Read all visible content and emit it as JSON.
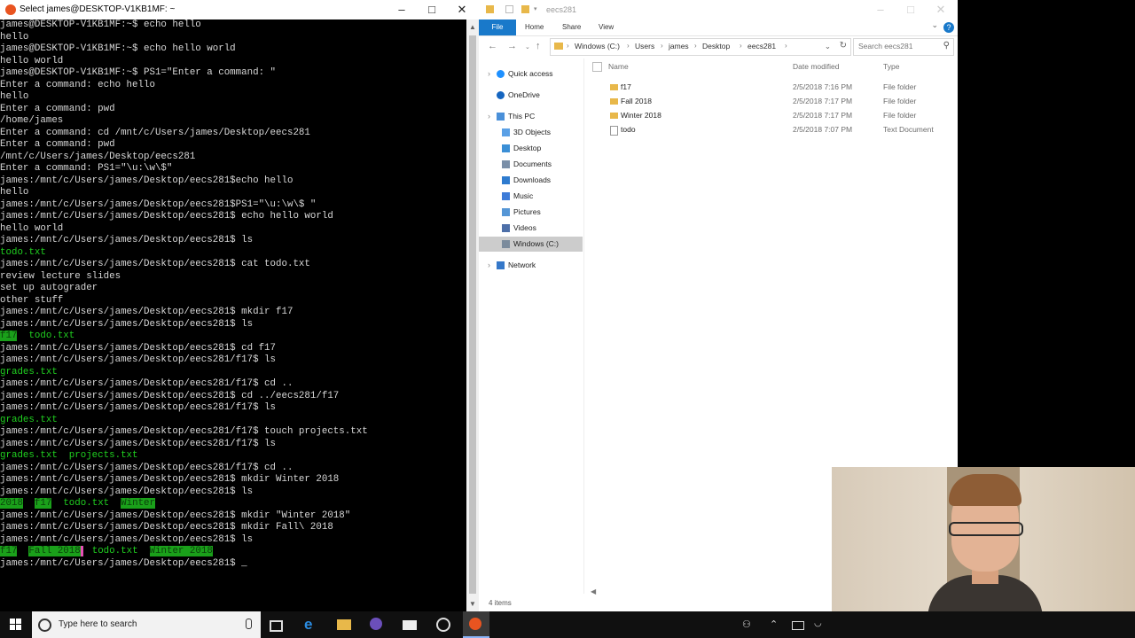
{
  "terminal": {
    "title": "Select james@DESKTOP-V1KB1MF: ~",
    "lines": [
      [
        {
          "t": "james@DESKTOP-V1KB1MF:~$ echo hello"
        }
      ],
      [
        {
          "t": "hello"
        }
      ],
      [
        {
          "t": "james@DESKTOP-V1KB1MF:~$ echo hello world"
        }
      ],
      [
        {
          "t": "hello world"
        }
      ],
      [
        {
          "t": "james@DESKTOP-V1KB1MF:~$ PS1=\"Enter a command: \""
        }
      ],
      [
        {
          "t": "Enter a command: echo hello"
        }
      ],
      [
        {
          "t": "hello"
        }
      ],
      [
        {
          "t": "Enter a command: pwd"
        }
      ],
      [
        {
          "t": "/home/james"
        }
      ],
      [
        {
          "t": "Enter a command: cd /mnt/c/Users/james/Desktop/eecs281"
        }
      ],
      [
        {
          "t": "Enter a command: pwd"
        }
      ],
      [
        {
          "t": "/mnt/c/Users/james/Desktop/eecs281"
        }
      ],
      [
        {
          "t": "Enter a command: PS1=\"\\u:\\w\\$\""
        }
      ],
      [
        {
          "t": "james:/mnt/c/Users/james/Desktop/eecs281$echo hello"
        }
      ],
      [
        {
          "t": "hello"
        }
      ],
      [
        {
          "t": "james:/mnt/c/Users/james/Desktop/eecs281$PS1=\"\\u:\\w\\$ \""
        }
      ],
      [
        {
          "t": "james:/mnt/c/Users/james/Desktop/eecs281$ echo hello world"
        }
      ],
      [
        {
          "t": "hello world"
        }
      ],
      [
        {
          "t": "james:/mnt/c/Users/james/Desktop/eecs281$ ls"
        }
      ],
      [
        {
          "t": "todo.txt",
          "c": "green"
        }
      ],
      [
        {
          "t": "james:/mnt/c/Users/james/Desktop/eecs281$ cat todo.txt"
        }
      ],
      [
        {
          "t": "review lecture slides"
        }
      ],
      [
        {
          "t": "set up autograder"
        }
      ],
      [
        {
          "t": "other stuff"
        }
      ],
      [
        {
          "t": "james:/mnt/c/Users/james/Desktop/eecs281$ mkdir f17"
        }
      ],
      [
        {
          "t": "james:/mnt/c/Users/james/Desktop/eecs281$ ls"
        }
      ],
      [
        {
          "t": "f17",
          "c": "hl"
        },
        {
          "t": "  "
        },
        {
          "t": "todo.txt",
          "c": "green"
        }
      ],
      [
        {
          "t": "james:/mnt/c/Users/james/Desktop/eecs281$ cd f17"
        }
      ],
      [
        {
          "t": "james:/mnt/c/Users/james/Desktop/eecs281/f17$ ls"
        }
      ],
      [
        {
          "t": "grades.txt",
          "c": "green"
        }
      ],
      [
        {
          "t": "james:/mnt/c/Users/james/Desktop/eecs281/f17$ cd .."
        }
      ],
      [
        {
          "t": "james:/mnt/c/Users/james/Desktop/eecs281$ cd ../eecs281/f17"
        }
      ],
      [
        {
          "t": "james:/mnt/c/Users/james/Desktop/eecs281/f17$ ls"
        }
      ],
      [
        {
          "t": "grades.txt",
          "c": "green"
        }
      ],
      [
        {
          "t": "james:/mnt/c/Users/james/Desktop/eecs281/f17$ touch projects.txt"
        }
      ],
      [
        {
          "t": "james:/mnt/c/Users/james/Desktop/eecs281/f17$ ls"
        }
      ],
      [
        {
          "t": "grades.txt",
          "c": "green"
        },
        {
          "t": "  "
        },
        {
          "t": "projects.txt",
          "c": "green"
        }
      ],
      [
        {
          "t": "james:/mnt/c/Users/james/Desktop/eecs281/f17$ cd .."
        }
      ],
      [
        {
          "t": "james:/mnt/c/Users/james/Desktop/eecs281$ mkdir Winter 2018"
        }
      ],
      [
        {
          "t": "james:/mnt/c/Users/james/Desktop/eecs281$ ls"
        }
      ],
      [
        {
          "t": "2018",
          "c": "hl"
        },
        {
          "t": "  "
        },
        {
          "t": "f17",
          "c": "hl"
        },
        {
          "t": "  "
        },
        {
          "t": "todo.txt",
          "c": "green"
        },
        {
          "t": "  "
        },
        {
          "t": "Winter",
          "c": "hl"
        }
      ],
      [
        {
          "t": "james:/mnt/c/Users/james/Desktop/eecs281$ mkdir \"Winter 2018\""
        }
      ],
      [
        {
          "t": "james:/mnt/c/Users/james/Desktop/eecs281$ mkdir Fall\\ 2018"
        }
      ],
      [
        {
          "t": "james:/mnt/c/Users/james/Desktop/eecs281$ ls"
        }
      ],
      [
        {
          "t": "f17",
          "c": "hl"
        },
        {
          "t": "  "
        },
        {
          "t": "Fall 2018",
          "c": "hlp"
        },
        {
          "t": "  "
        },
        {
          "t": "todo.txt",
          "c": "green"
        },
        {
          "t": "  "
        },
        {
          "t": "Winter 2018",
          "c": "hl"
        }
      ],
      [
        {
          "t": "james:/mnt/c/Users/james/Desktop/eecs281$ "
        },
        {
          "t": "_",
          "c": "cursor"
        }
      ]
    ]
  },
  "explorer": {
    "title": "eecs281",
    "ribbon_tabs": [
      "File",
      "Home",
      "Share",
      "View"
    ],
    "breadcrumb": [
      "Windows (C:)",
      "Users",
      "james",
      "Desktop",
      "eecs281"
    ],
    "search_placeholder": "Search eecs281",
    "nav": [
      {
        "label": "Quick access",
        "icon": "star-icon",
        "color": "#1e90ff"
      },
      {
        "label": "OneDrive",
        "icon": "cloud-icon",
        "color": "#1565c0"
      },
      {
        "label": "This PC",
        "icon": "computer-icon",
        "color": "#4a90d9"
      },
      {
        "label": "3D Objects",
        "icon": "cube-icon",
        "color": "#5aa0e6"
      },
      {
        "label": "Desktop",
        "icon": "desktop-icon",
        "color": "#3b8fd6"
      },
      {
        "label": "Documents",
        "icon": "documents-icon",
        "color": "#7a8fa8"
      },
      {
        "label": "Downloads",
        "icon": "download-icon",
        "color": "#2e7bcf"
      },
      {
        "label": "Music",
        "icon": "music-icon",
        "color": "#3d7bd8"
      },
      {
        "label": "Pictures",
        "icon": "pictures-icon",
        "color": "#5596d6"
      },
      {
        "label": "Videos",
        "icon": "videos-icon",
        "color": "#4d6fa8"
      },
      {
        "label": "Windows (C:)",
        "icon": "drive-icon",
        "color": "#7b8b9c"
      },
      {
        "label": "Network",
        "icon": "network-icon",
        "color": "#3578c9"
      }
    ],
    "columns": {
      "name": "Name",
      "date": "Date modified",
      "type": "Type"
    },
    "files": [
      {
        "name": "f17",
        "date": "2/5/2018 7:16 PM",
        "type": "File folder",
        "icon": "folder-icon"
      },
      {
        "name": "Fall 2018",
        "date": "2/5/2018 7:17 PM",
        "type": "File folder",
        "icon": "folder-icon"
      },
      {
        "name": "Winter 2018",
        "date": "2/5/2018 7:17 PM",
        "type": "File folder",
        "icon": "folder-icon"
      },
      {
        "name": "todo",
        "date": "2/5/2018 7:07 PM",
        "type": "Text Document",
        "icon": "text-file-icon"
      }
    ],
    "status": "4 items"
  },
  "taskbar": {
    "search_placeholder": "Type here to search"
  },
  "colors": {
    "accent": "#1979ca",
    "terminal_green": "#20d020",
    "folder": "#e8b84a"
  }
}
